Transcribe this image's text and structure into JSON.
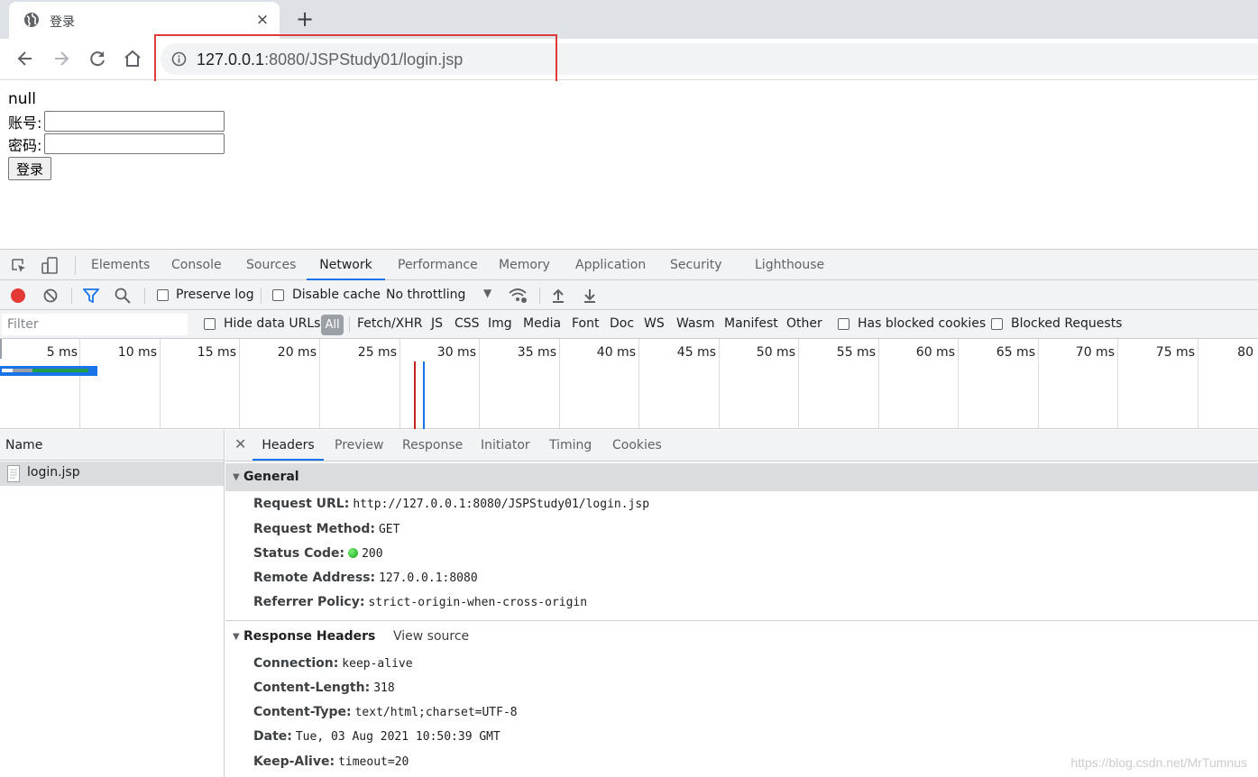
{
  "browser": {
    "tab_title": "登录",
    "tab_close": "×",
    "new_tab": "+",
    "url_host": "127.0.0.1",
    "url_rest": ":8080/JSPStudy01/login.jsp"
  },
  "page": {
    "message": "null",
    "account_label": "账号:",
    "password_label": "密码:",
    "account_value": "",
    "password_value": "",
    "login_button": "登录"
  },
  "devtools": {
    "tabs": [
      "Elements",
      "Console",
      "Sources",
      "Network",
      "Performance",
      "Memory",
      "Application",
      "Security",
      "Lighthouse"
    ],
    "active_tab": "Network",
    "toolbar": {
      "preserve_log": "Preserve log",
      "disable_cache": "Disable cache",
      "throttling": "No throttling"
    },
    "filter": {
      "placeholder": "Filter",
      "hide_data_urls": "Hide data URLs",
      "all": "All",
      "types": [
        "Fetch/XHR",
        "JS",
        "CSS",
        "Img",
        "Media",
        "Font",
        "Doc",
        "WS",
        "Wasm",
        "Manifest",
        "Other"
      ],
      "has_blocked_cookies": "Has blocked cookies",
      "blocked_requests": "Blocked Requests"
    },
    "timeline_ticks": [
      "5 ms",
      "10 ms",
      "15 ms",
      "20 ms",
      "25 ms",
      "30 ms",
      "35 ms",
      "40 ms",
      "45 ms",
      "50 ms",
      "55 ms",
      "60 ms",
      "65 ms",
      "70 ms",
      "75 ms",
      "80"
    ],
    "request_list": {
      "header": "Name",
      "requests": [
        "login.jsp"
      ]
    },
    "detail_tabs": [
      "Headers",
      "Preview",
      "Response",
      "Initiator",
      "Timing",
      "Cookies"
    ],
    "active_detail_tab": "Headers",
    "general": {
      "title": "General",
      "request_url_key": "Request URL:",
      "request_url": "http://127.0.0.1:8080/JSPStudy01/login.jsp",
      "request_method_key": "Request Method:",
      "request_method": "GET",
      "status_code_key": "Status Code:",
      "status_code": "200",
      "remote_address_key": "Remote Address:",
      "remote_address": "127.0.0.1:8080",
      "referrer_policy_key": "Referrer Policy:",
      "referrer_policy": "strict-origin-when-cross-origin"
    },
    "response_headers": {
      "title": "Response Headers",
      "view_source": "View source",
      "connection_key": "Connection:",
      "connection": "keep-alive",
      "content_length_key": "Content-Length:",
      "content_length": "318",
      "content_type_key": "Content-Type:",
      "content_type": "text/html;charset=UTF-8",
      "date_key": "Date:",
      "date": "Tue, 03 Aug 2021 10:50:39 GMT",
      "keep_alive_key": "Keep-Alive:",
      "keep_alive": "timeout=20"
    }
  },
  "watermark": "https://blog.csdn.net/MrTumnus",
  "colors": {
    "highlight": "#e03a3a",
    "accent": "#1a73e8",
    "record": "#e53935",
    "status_ok": "#12a312"
  }
}
